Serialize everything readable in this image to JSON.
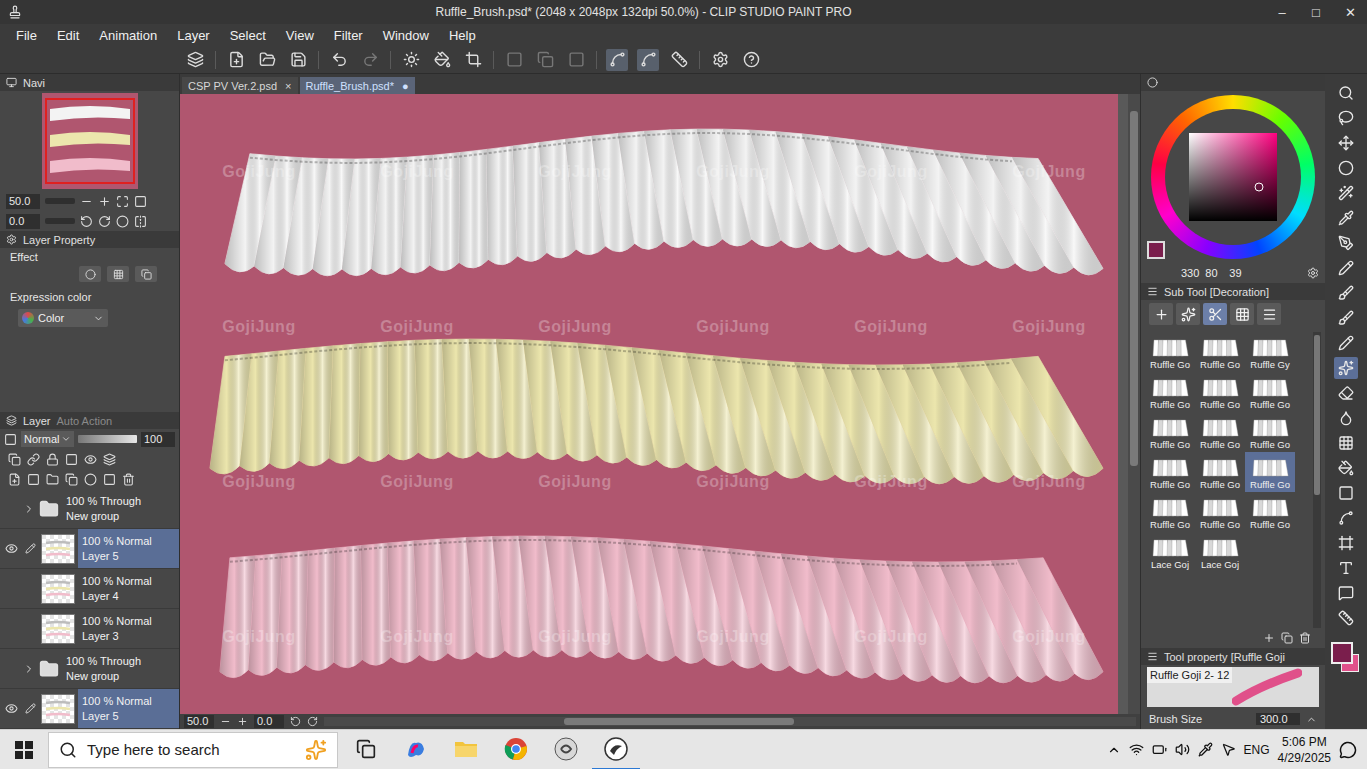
{
  "window": {
    "title": "Ruffle_Brush.psd* (2048 x 2048px 132dpi 50.0%) - CLIP STUDIO PAINT PRO",
    "controls": [
      "–",
      "□",
      "✕"
    ]
  },
  "menu": [
    "File",
    "Edit",
    "Animation",
    "Layer",
    "Select",
    "View",
    "Filter",
    "Window",
    "Help"
  ],
  "tabs": [
    {
      "label": "CSP PV Ver.2.psd",
      "mark": "×",
      "selected": false
    },
    {
      "label": "Ruffle_Brush.psd*",
      "mark": "●",
      "selected": true
    }
  ],
  "navigator": {
    "title": "Navi",
    "zoom": "50.0",
    "angle": "0.0"
  },
  "layer_property": {
    "title": "Layer Property",
    "effect_label": "Effect",
    "expression_label": "Expression color",
    "expression_value": "Color"
  },
  "layer_panel": {
    "title": "Layer",
    "other_tab": "Auto Action",
    "blend": "Normal",
    "opacity": "100",
    "opacity_level": 1
  },
  "layers": [
    {
      "kind": "folder",
      "mode": "100 % Through",
      "name": "New group",
      "visible": false,
      "selected": false,
      "expanded": false
    },
    {
      "kind": "layer",
      "mode": "100 % Normal",
      "name": "Layer 5",
      "visible": true,
      "selected": true
    },
    {
      "kind": "layer",
      "mode": "100 % Normal",
      "name": "Layer 4",
      "visible": false,
      "selected": false
    },
    {
      "kind": "layer",
      "mode": "100 % Normal",
      "name": "Layer 3",
      "visible": false,
      "selected": false
    },
    {
      "kind": "folder",
      "mode": "100 % Through",
      "name": "New group",
      "visible": false,
      "selected": false,
      "expanded": false
    },
    {
      "kind": "layer",
      "mode": "100 % Normal",
      "name": "Layer 5",
      "visible": true,
      "selected": true
    }
  ],
  "canvas": {
    "color": "#b0566f",
    "watermark": "GojiJung",
    "zoom": "50.0",
    "angle": "0.0"
  },
  "ruffles": [
    {
      "color": "#f3f3f3"
    },
    {
      "color": "#ece6ad"
    },
    {
      "color": "#f1bccb"
    }
  ],
  "color": {
    "hue": "330",
    "saturation": "80",
    "value": "39",
    "main": "#7a1e4c",
    "sub": "#e0508a"
  },
  "sub_tool": {
    "title": "Sub Tool [Decoration]",
    "groups": [
      {
        "selected": false
      },
      {
        "selected": false
      },
      {
        "selected": true
      },
      {
        "selected": false
      },
      {
        "selected": false
      }
    ],
    "items": [
      {
        "label": "Ruffle Go",
        "selected": false
      },
      {
        "label": "Ruffle Go",
        "selected": false
      },
      {
        "label": "Ruffle Gy",
        "selected": false
      },
      {
        "label": "Ruffle Go",
        "selected": false
      },
      {
        "label": "Ruffle Go",
        "selected": false
      },
      {
        "label": "Ruffle Go",
        "selected": false
      },
      {
        "label": "Ruffle Go",
        "selected": false
      },
      {
        "label": "Ruffle Go",
        "selected": false
      },
      {
        "label": "Ruffle Go",
        "selected": false
      },
      {
        "label": "Ruffle Go",
        "selected": false
      },
      {
        "label": "Ruffle Go",
        "selected": false
      },
      {
        "label": "Ruffle Go",
        "selected": true
      },
      {
        "label": "Ruffle Go",
        "selected": false
      },
      {
        "label": "Ruffle Go",
        "selected": false
      },
      {
        "label": "Ruffle Go",
        "selected": false
      },
      {
        "label": "Lace Goj",
        "selected": false
      },
      {
        "label": "Lace Goj",
        "selected": false
      }
    ]
  },
  "tool_property": {
    "title": "Tool property [Ruffle Goji",
    "preset": "Ruffle Goji 2- 12",
    "size_label": "Brush Size",
    "size": "300.0"
  },
  "tools": [
    {
      "selected": false
    },
    {
      "selected": false
    },
    {
      "selected": false
    },
    {
      "selected": false
    },
    {
      "selected": false
    },
    {
      "selected": false
    },
    {
      "selected": false
    },
    {
      "selected": false
    },
    {
      "selected": false
    },
    {
      "selected": false
    },
    {
      "selected": false
    },
    {
      "selected": true
    },
    {
      "selected": false
    },
    {
      "selected": false
    },
    {
      "selected": false
    },
    {
      "selected": false
    },
    {
      "selected": false
    },
    {
      "selected": false
    },
    {
      "selected": false
    },
    {
      "selected": false
    },
    {
      "selected": false
    },
    {
      "selected": false
    }
  ],
  "taskbar": {
    "search": "Type here to search",
    "language": "ENG",
    "time": "5:06 PM",
    "date": "4/29/2025"
  }
}
